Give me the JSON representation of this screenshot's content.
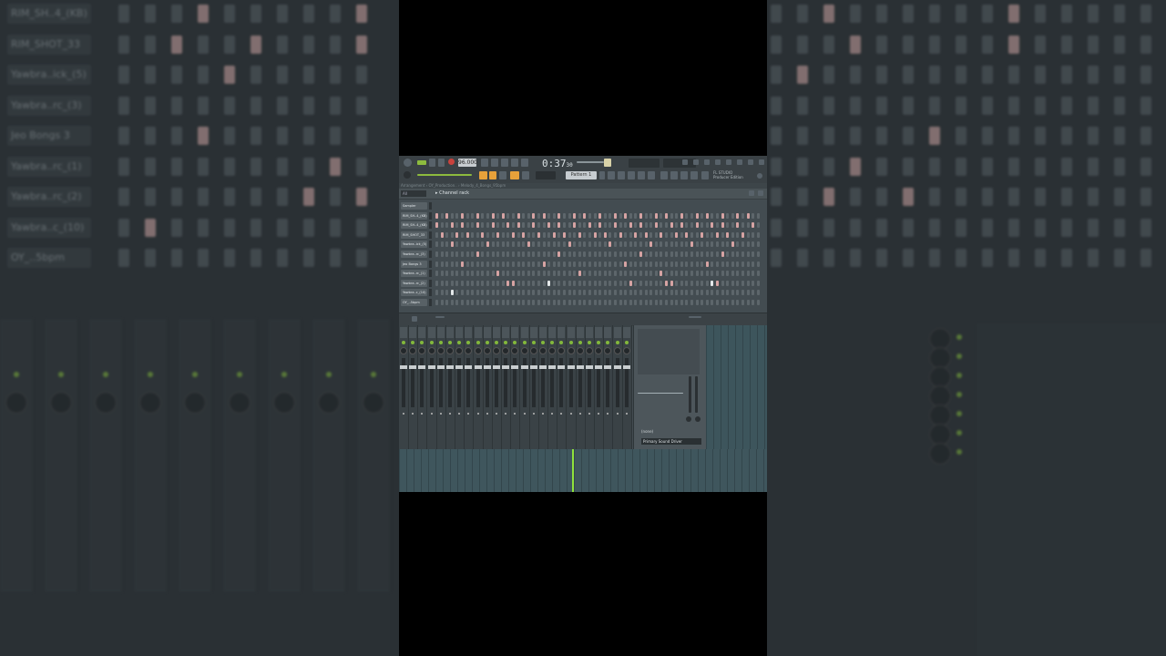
{
  "left_bg": {
    "channels": [
      {
        "name": "RIM_SH..4_(KB)"
      },
      {
        "name": "RIM_SHOT_33"
      },
      {
        "name": "Yawbra..ick_(5)"
      },
      {
        "name": "Yawbra..rc_(3)"
      },
      {
        "name": "Jeo Bongs 3"
      },
      {
        "name": "Yawbra..rc_(1)"
      },
      {
        "name": "Yawbra..rc_(2)"
      },
      {
        "name": "Yawbra..c_(10)"
      },
      {
        "name": "OY_..5bpm"
      }
    ]
  },
  "toolbar": {
    "tempo": "96.000",
    "time": "0:37",
    "time_sub": "30",
    "pattern": "Pattern 1",
    "info_line1": "FL STUDIO",
    "info_line2": "Producer Edition"
  },
  "breadcrumb": "Arrangement › OY_Production.. › Melody_4_Bongs_95bpm",
  "channel_rack": {
    "filter": "All",
    "title": "Channel rack",
    "channels": [
      {
        "name": "Sampler"
      },
      {
        "name": "RIM_SH..4_(KB)"
      },
      {
        "name": "RIM_SH..4_(KB)"
      },
      {
        "name": "RIM_SHOT_33"
      },
      {
        "name": "Yawbra..ick_(5)"
      },
      {
        "name": "Yawbra..rc_(3)"
      },
      {
        "name": "Jeo Bongs 3"
      },
      {
        "name": "Yawbra..rc_(1)"
      },
      {
        "name": "Yawbra..rc_(2)"
      },
      {
        "name": "Yawbra..c_(10)"
      },
      {
        "name": "OY_..5bpm"
      }
    ]
  },
  "mixer": {
    "fx_none": "(none)",
    "output": "Primary Sound Driver"
  }
}
